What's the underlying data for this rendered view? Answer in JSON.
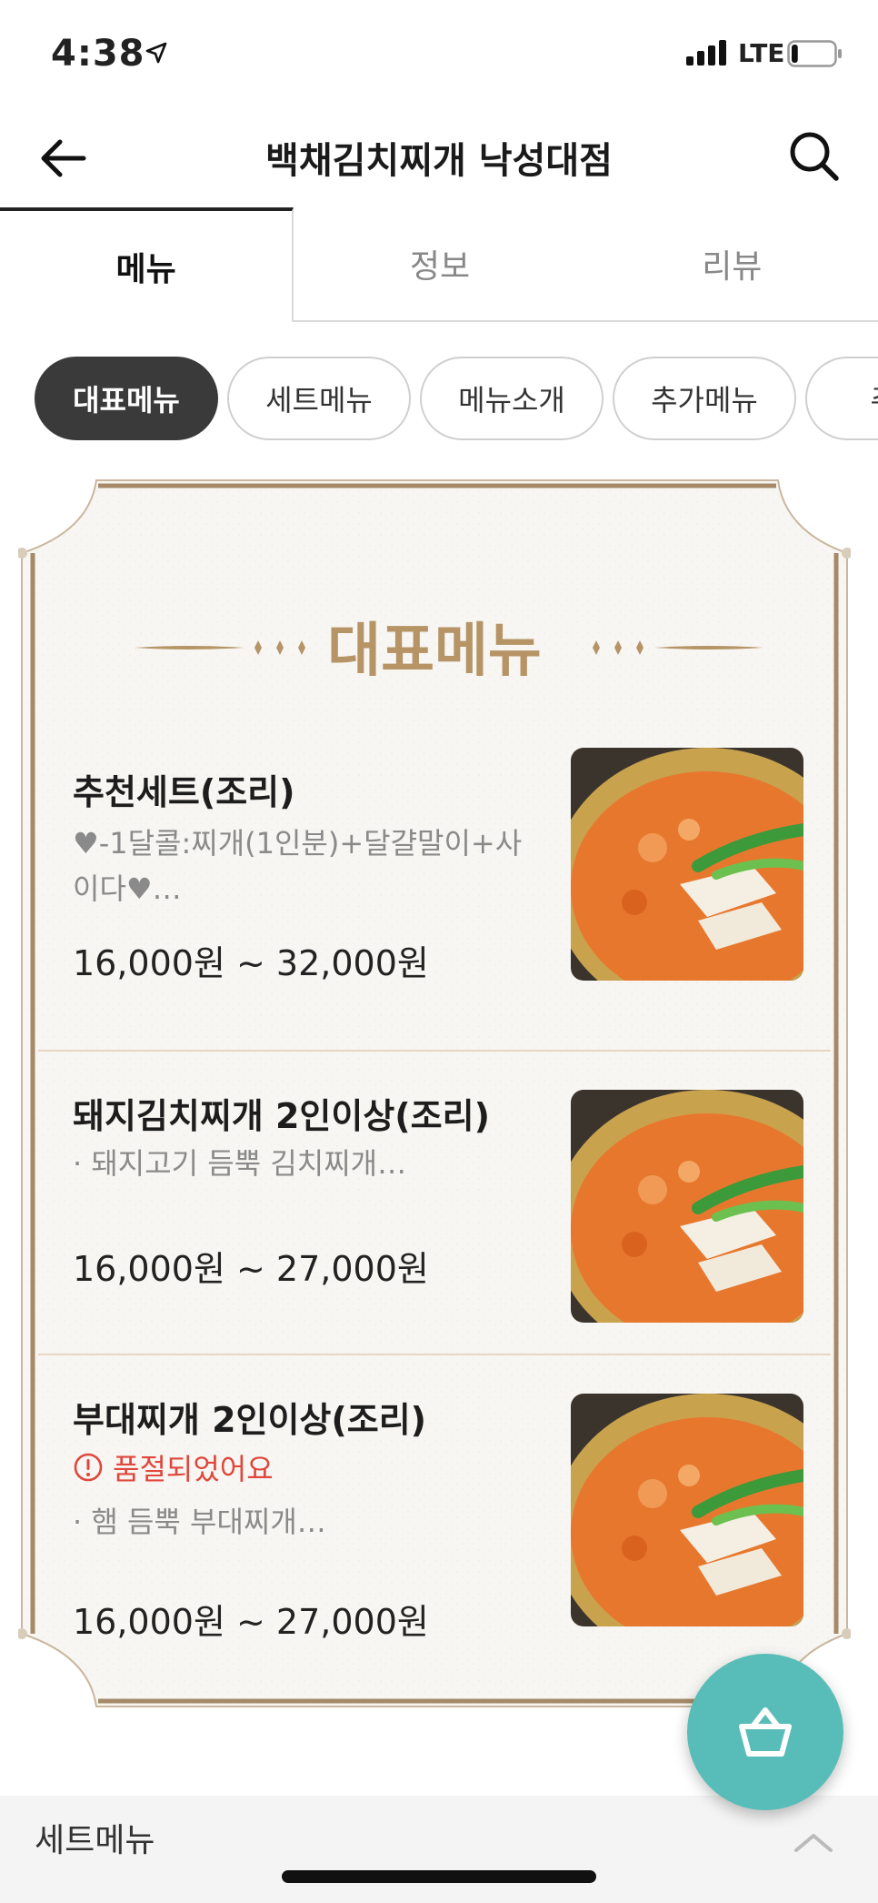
{
  "status_bar": {
    "time": "4:38",
    "carrier": "LTE",
    "battery_level": 0.15
  },
  "header": {
    "title": "백채김치찌개 낙성대점"
  },
  "tabs": [
    {
      "label": "메뉴",
      "active": true
    },
    {
      "label": "정보",
      "active": false
    },
    {
      "label": "리뷰",
      "active": false
    }
  ],
  "category_chips": [
    {
      "label": "대표메뉴",
      "active": true
    },
    {
      "label": "세트메뉴",
      "active": false
    },
    {
      "label": "메뉴소개",
      "active": false
    },
    {
      "label": "추가메뉴",
      "active": false
    },
    {
      "label": "주류",
      "active": false
    }
  ],
  "section": {
    "title": "대표메뉴"
  },
  "menu_items": [
    {
      "name": "추천세트(조리)",
      "description": "♥-1달콜:찌개(1인분)+달걀말이+사이다♥…",
      "sold_out": false,
      "sold_out_text": "",
      "price": "16,000원 ~ 32,000원"
    },
    {
      "name": "돼지김치찌개 2인이상(조리)",
      "description": "· 돼지고기 듬뿍 김치찌개…",
      "sold_out": false,
      "sold_out_text": "",
      "price": "16,000원 ~ 27,000원"
    },
    {
      "name": "부대찌개 2인이상(조리)",
      "description": "· 햄 듬뿍 부대찌개…",
      "sold_out": true,
      "sold_out_text": "품절되었어요",
      "price": "16,000원 ~ 27,000원"
    }
  ],
  "bottom_bar": {
    "label": "세트메뉴"
  },
  "colors": {
    "accent_teal": "#58bdb8",
    "gold": "#b69466",
    "soldout_red": "#e0473c",
    "chip_active": "#3a3a3a"
  },
  "icons": [
    "location-arrow-icon",
    "signal-icon",
    "battery-icon",
    "back-arrow-icon",
    "search-icon",
    "alert-circle-icon",
    "cart-basket-icon",
    "chevron-up-icon"
  ]
}
